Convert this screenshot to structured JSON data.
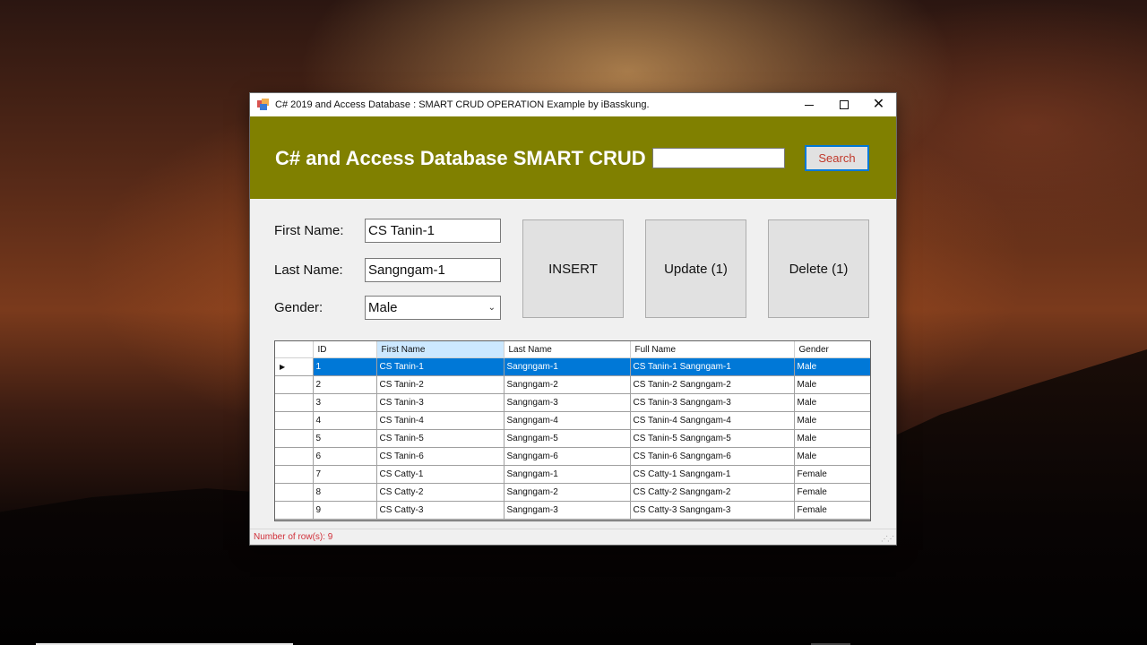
{
  "window": {
    "title": "C# 2019 and Access Database : SMART CRUD OPERATION Example by iBasskung."
  },
  "header": {
    "title": "C# and Access Database SMART CRUD",
    "search_value": "",
    "search_label": "Search"
  },
  "form": {
    "first_name_label": "First Name:",
    "first_name_value": "CS Tanin-1",
    "last_name_label": "Last Name:",
    "last_name_value": "Sangngam-1",
    "gender_label": "Gender:",
    "gender_value": "Male"
  },
  "actions": {
    "insert_label": "INSERT",
    "update_label": "Update (1)",
    "delete_label": "Delete (1)"
  },
  "grid": {
    "columns": [
      "ID",
      "First Name",
      "Last Name",
      "Full Name",
      "Gender"
    ],
    "selected_row": 0,
    "rows": [
      [
        "1",
        "CS Tanin-1",
        "Sangngam-1",
        "CS Tanin-1 Sangngam-1",
        "Male"
      ],
      [
        "2",
        "CS Tanin-2",
        "Sangngam-2",
        "CS Tanin-2 Sangngam-2",
        "Male"
      ],
      [
        "3",
        "CS Tanin-3",
        "Sangngam-3",
        "CS Tanin-3 Sangngam-3",
        "Male"
      ],
      [
        "4",
        "CS Tanin-4",
        "Sangngam-4",
        "CS Tanin-4 Sangngam-4",
        "Male"
      ],
      [
        "5",
        "CS Tanin-5",
        "Sangngam-5",
        "CS Tanin-5 Sangngam-5",
        "Male"
      ],
      [
        "6",
        "CS Tanin-6",
        "Sangngam-6",
        "CS Tanin-6 Sangngam-6",
        "Male"
      ],
      [
        "7",
        "CS Catty-1",
        "Sangngam-1",
        "CS Catty-1 Sangngam-1",
        "Female"
      ],
      [
        "8",
        "CS Catty-2",
        "Sangngam-2",
        "CS Catty-2 Sangngam-2",
        "Female"
      ],
      [
        "9",
        "CS Catty-3",
        "Sangngam-3",
        "CS Catty-3 Sangngam-3",
        "Female"
      ]
    ]
  },
  "status": {
    "text": "Number of row(s): 9"
  },
  "colors": {
    "header_band": "#808000",
    "selection": "#0078d7",
    "status_text": "#d0303a"
  }
}
